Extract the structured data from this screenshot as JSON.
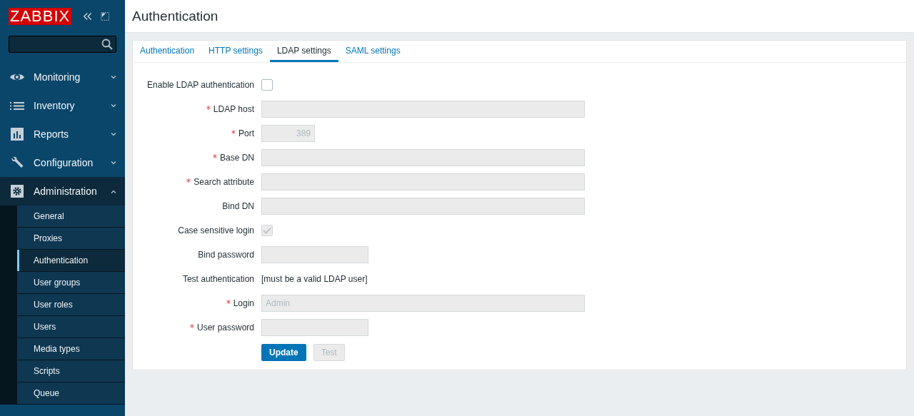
{
  "sidebar": {
    "logo": "ZABBIX",
    "menu": [
      {
        "label": "Monitoring",
        "kind": "eye",
        "expanded": false
      },
      {
        "label": "Inventory",
        "kind": "list",
        "expanded": false
      },
      {
        "label": "Reports",
        "kind": "chart",
        "expanded": false
      },
      {
        "label": "Configuration",
        "kind": "wrench",
        "expanded": false
      },
      {
        "label": "Administration",
        "kind": "gear",
        "expanded": true,
        "children": [
          {
            "label": "General",
            "selected": false
          },
          {
            "label": "Proxies",
            "selected": false
          },
          {
            "label": "Authentication",
            "selected": true
          },
          {
            "label": "User groups",
            "selected": false
          },
          {
            "label": "User roles",
            "selected": false
          },
          {
            "label": "Users",
            "selected": false
          },
          {
            "label": "Media types",
            "selected": false
          },
          {
            "label": "Scripts",
            "selected": false
          },
          {
            "label": "Queue",
            "selected": false
          }
        ]
      }
    ]
  },
  "page": {
    "title": "Authentication"
  },
  "tabs": [
    {
      "label": "Authentication",
      "selected": false
    },
    {
      "label": "HTTP settings",
      "selected": false
    },
    {
      "label": "LDAP settings",
      "selected": true
    },
    {
      "label": "SAML settings",
      "selected": false
    }
  ],
  "form": [
    {
      "kind": "checkbox",
      "label": "Enable LDAP authentication",
      "required": false,
      "checked": false,
      "disabled": false
    },
    {
      "kind": "text",
      "label": "LDAP host",
      "required": true,
      "disabled": true
    },
    {
      "kind": "number",
      "label": "Port",
      "required": true,
      "value": "389",
      "disabled": true
    },
    {
      "kind": "text",
      "label": "Base DN",
      "required": true,
      "disabled": true
    },
    {
      "kind": "text",
      "label": "Search attribute",
      "required": true,
      "disabled": true
    },
    {
      "kind": "text",
      "label": "Bind DN",
      "required": false,
      "disabled": true
    },
    {
      "kind": "checkbox",
      "label": "Case sensitive login",
      "required": false,
      "checked": true,
      "disabled": true
    },
    {
      "kind": "password",
      "label": "Bind password",
      "required": false,
      "disabled": true
    },
    {
      "kind": "note",
      "label": "Test authentication",
      "text": "[must be a valid LDAP user]"
    },
    {
      "kind": "text",
      "label": "Login",
      "required": true,
      "value": "Admin",
      "disabled": true
    },
    {
      "kind": "password",
      "label": "User password",
      "required": true,
      "disabled": true
    }
  ],
  "buttons": [
    {
      "label": "Update",
      "kind": "primary",
      "disabled": false
    },
    {
      "label": "Test",
      "kind": "secondary",
      "disabled": true
    }
  ]
}
